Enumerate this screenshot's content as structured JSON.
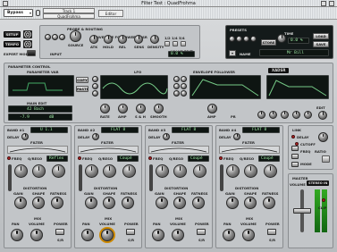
{
  "window": {
    "title": "Filter Test : QuadFrohma"
  },
  "top": {
    "bypass": "Bypass",
    "track": "Track 1",
    "plugin": "QuadFrohma",
    "editor": "Editor"
  },
  "left": {
    "setup": "SETUP",
    "tempo": "TEMPO",
    "expert": "EXPERT MODE"
  },
  "probe": {
    "title": "PROBE & ROUTING",
    "source": "SOURCE",
    "env_follower": "ENVELOPE FOLLOWER",
    "adsr": "ADSR",
    "atk": "ATK",
    "hold": "HOLD",
    "rel": "REL",
    "sens": "SENS",
    "density": "DENSITY",
    "divs": "1/2 1/4 3/4",
    "value_edit": "VALUE EDIT",
    "value": "0.0 %",
    "input": "INPUT"
  },
  "presets": {
    "title": "PRESETS",
    "time_label": "TIME",
    "time": "0.0 %",
    "store": "STORE",
    "load": "LOAD",
    "save": "SAVE",
    "name_label": "NAME",
    "name": "Mr Bill"
  },
  "param": {
    "title": "PARAMETER CONTROL",
    "param_var": "PARAMETER VAR",
    "lfo": "LFO",
    "env_follower": "ENVELOPE FOLLOWER",
    "xlabel": "XADSR",
    "copy": "COPY",
    "paste": "PASTE",
    "main_edit": "MAIN EDIT",
    "main_val": "42 Bach",
    "db": "-7.9",
    "db_unit": "dB",
    "rate": "RATE",
    "pr": "PR",
    "amp": "AMP",
    "sh": "S & H",
    "smooth": "SMOOTH",
    "edit": "EDIT"
  },
  "bands": [
    {
      "title": "BAND #1",
      "sub": "U 1.1",
      "fil": "FILTER",
      "mode": "Reflex"
    },
    {
      "title": "BAND #2",
      "sub": "FLAT 8",
      "fil": "FILTER",
      "mode": "Coupé"
    },
    {
      "title": "BAND #3",
      "sub": "FLAT 8",
      "fil": "FILTER",
      "mode": "Coupé"
    },
    {
      "title": "BAND #4",
      "sub": "FLAT 8",
      "fil": "FILTER",
      "mode": "Coupé"
    }
  ],
  "band_labels": {
    "delay": "DELAY",
    "freq": "FREQ",
    "reso": "Q/RESO",
    "distortion": "DISTORTION",
    "gain": "GAIN",
    "shape": "SHAPE",
    "fatness": "FATNESS",
    "mix": "MIX",
    "pan": "PAN",
    "volume": "VOLUME",
    "power": "POWER",
    "solo": "S/R"
  },
  "link": {
    "title": "LINK",
    "delay": "DELAY",
    "cutoff": "CUTOFF",
    "freq": "FREQ",
    "ratio": "RATIO",
    "mode": "MODE"
  },
  "master": {
    "title": "MASTER",
    "volume": "VOLUME",
    "mode": "STEREO IN",
    "clip": "CLIP"
  },
  "colors": {
    "lcd_bg": "#0e1512",
    "lcd_fg": "#9de7a4",
    "accent_red": "#b22222",
    "panel": "#c9ccce"
  }
}
